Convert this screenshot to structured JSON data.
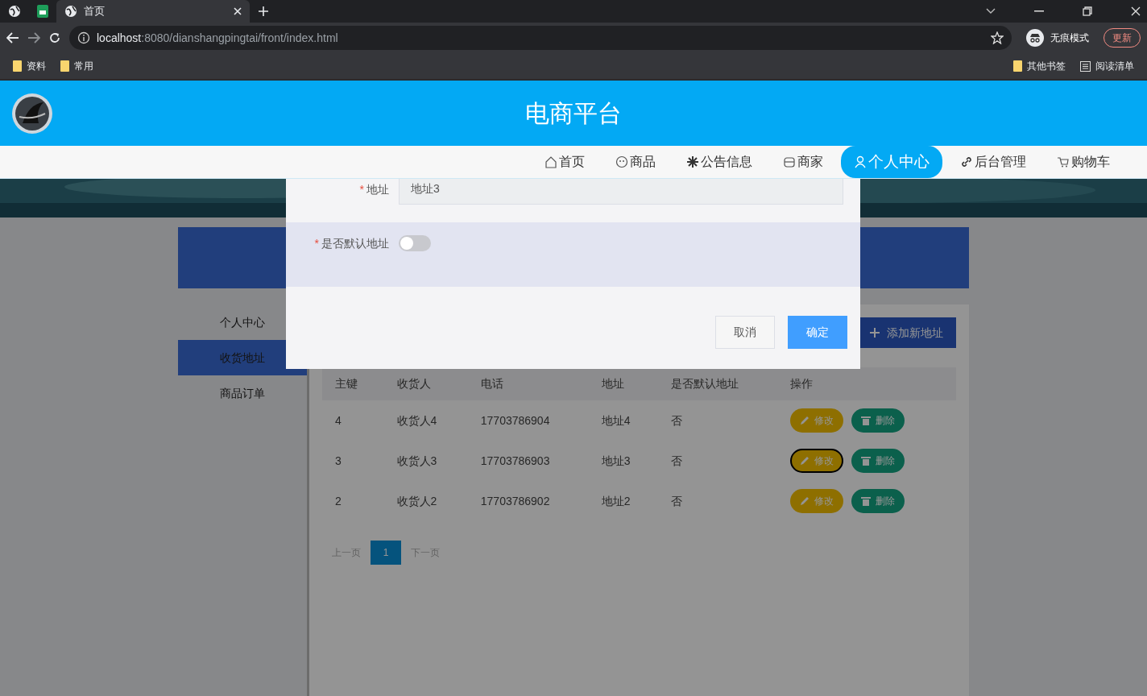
{
  "browser": {
    "tabs": [
      {
        "title": "首页",
        "selected": true
      }
    ],
    "url_host": "localhost",
    "url_path": ":8080/dianshangpingtai/front/index.html",
    "profile": "无痕模式",
    "update_button": "更新",
    "bookmarks": [
      "资料",
      "常用"
    ],
    "other_bookmarks": "其他书签",
    "reading_list": "阅读清单"
  },
  "site": {
    "title": "电商平台"
  },
  "nav": [
    {
      "label": "首页",
      "selected": false
    },
    {
      "label": "商品",
      "selected": false
    },
    {
      "label": "公告信息",
      "selected": false
    },
    {
      "label": "商家",
      "selected": false
    },
    {
      "label": "个人中心",
      "selected": true
    },
    {
      "label": "后台管理",
      "selected": false
    },
    {
      "label": "购物车",
      "selected": false
    }
  ],
  "sidebar": [
    {
      "label": "个人中心",
      "selected": false
    },
    {
      "label": "收货地址",
      "selected": true
    },
    {
      "label": "商品订单",
      "selected": false
    }
  ],
  "add_button": "添加新地址",
  "table": {
    "columns": [
      "主键",
      "收货人",
      "电话",
      "地址",
      "是否默认地址",
      "操作"
    ],
    "rows": [
      {
        "cells": [
          "4",
          "收货人4",
          "17703786904",
          "地址4",
          "否"
        ],
        "edit": "修改",
        "delete": "删除",
        "focused": false
      },
      {
        "cells": [
          "3",
          "收货人3",
          "17703786903",
          "地址3",
          "否"
        ],
        "edit": "修改",
        "delete": "删除",
        "focused": true
      },
      {
        "cells": [
          "2",
          "收货人2",
          "17703786902",
          "地址2",
          "否"
        ],
        "edit": "修改",
        "delete": "删除",
        "focused": false
      }
    ]
  },
  "pagination": {
    "prev": "上一页",
    "pages": [
      {
        "label": "1",
        "selected": true
      }
    ],
    "next": "下一页"
  },
  "dialog": {
    "fields": [
      {
        "kind": "text",
        "label": "地址",
        "required_mark": "*",
        "value": "地址3"
      },
      {
        "kind": "switch",
        "label": "是否默认地址",
        "required_mark": "*",
        "on": false
      }
    ],
    "buttons": [
      {
        "label": "取消",
        "kind": "default"
      },
      {
        "label": "确定",
        "kind": "primary"
      }
    ]
  }
}
